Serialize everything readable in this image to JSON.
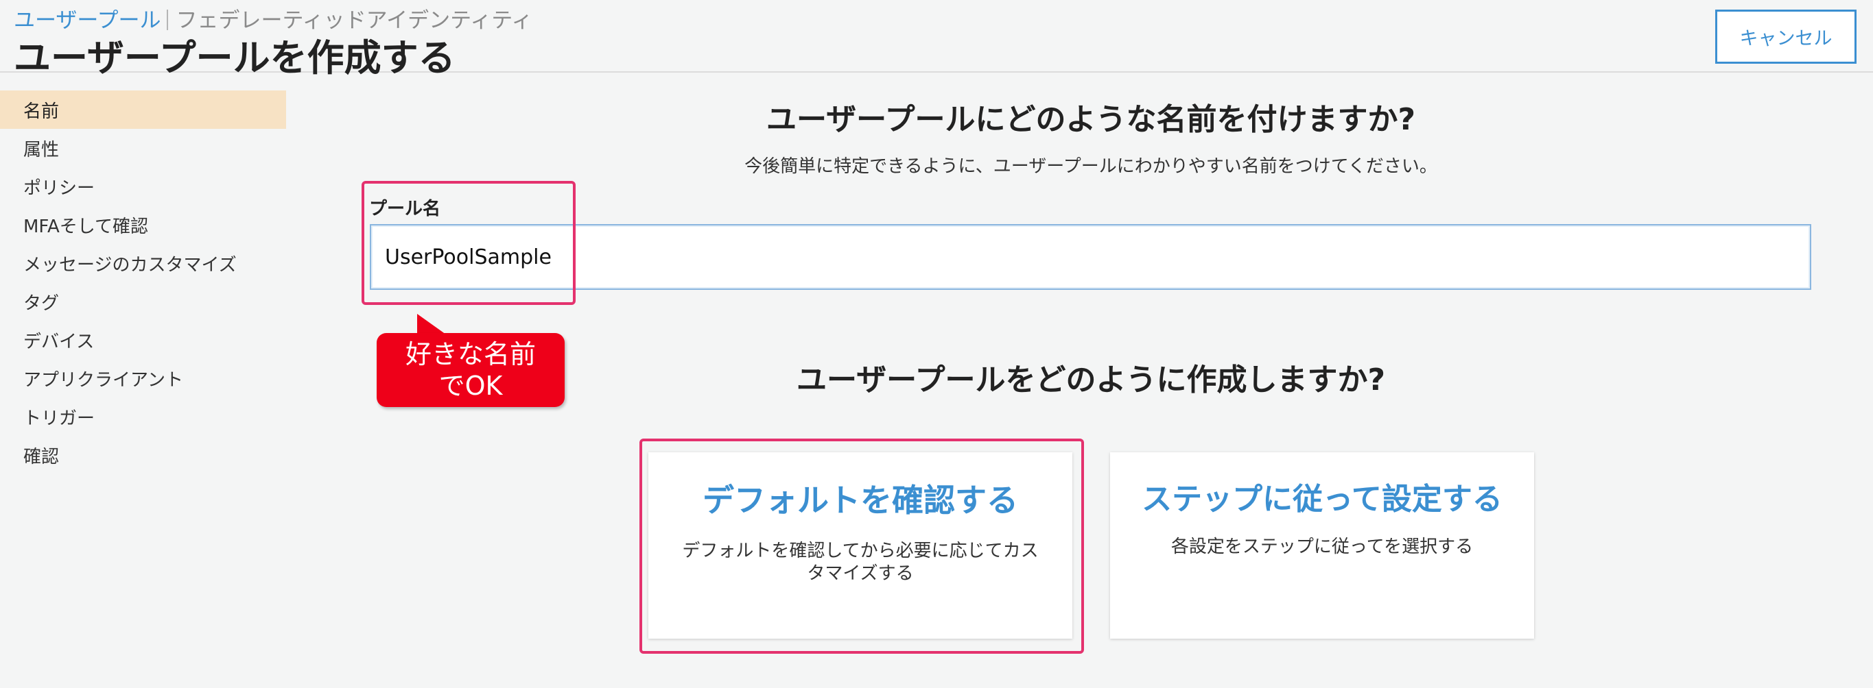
{
  "header": {
    "breadcrumb_root": "ユーザープール",
    "breadcrumb_current": "フェデレーティッドアイデンティティ",
    "title": "ユーザープールを作成する",
    "cancel_label": "キャンセル"
  },
  "sidebar": {
    "items": [
      {
        "label": "名前",
        "active": true
      },
      {
        "label": "属性"
      },
      {
        "label": "ポリシー"
      },
      {
        "label": "MFAそして確認"
      },
      {
        "label": "メッセージのカスタマイズ"
      },
      {
        "label": "タグ"
      },
      {
        "label": "デバイス"
      },
      {
        "label": "アプリクライアント"
      },
      {
        "label": "トリガー"
      },
      {
        "label": "確認"
      }
    ]
  },
  "name_section": {
    "heading": "ユーザープールにどのような名前を付けますか?",
    "subtext": "今後簡単に特定できるように、ユーザープールにわかりやすい名前をつけてください。",
    "field_label": "プール名",
    "field_value": "UserPoolSample"
  },
  "callout": {
    "line1": "好きな名前",
    "line2": "でOK"
  },
  "create_section": {
    "heading": "ユーザープールをどのように作成しますか?",
    "options": [
      {
        "title": "デフォルトを確認する",
        "desc": "デフォルトを確認してから必要に応じてカスタマイズする"
      },
      {
        "title": "ステップに従って設定する",
        "desc": "各設定をステップに従ってを選択する"
      }
    ]
  },
  "colors": {
    "accent": "#3b8fd1",
    "active_nav": "#f7e2c4",
    "highlight": "#e4326e",
    "callout": "#ee0019"
  }
}
